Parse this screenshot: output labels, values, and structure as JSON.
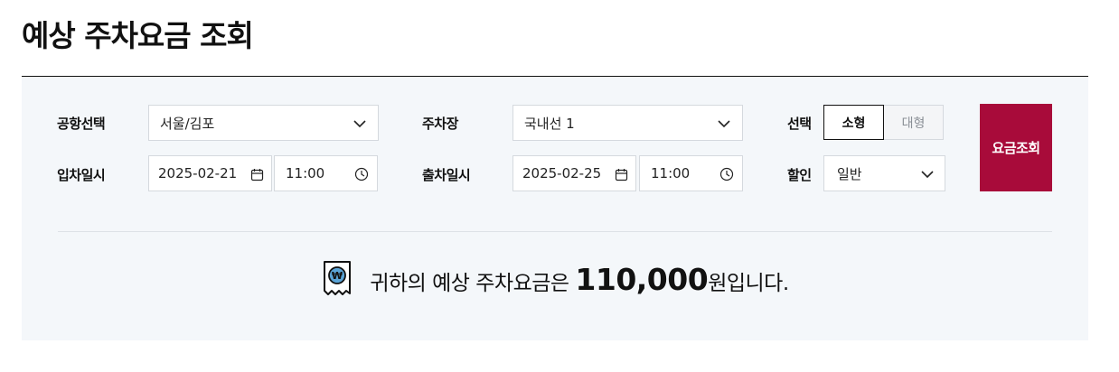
{
  "header": {
    "title": "예상 주차요금 조회"
  },
  "form": {
    "airport": {
      "label": "공항선택",
      "value": "서울/김포"
    },
    "parking_lot": {
      "label": "주차장",
      "value": "국내선 1"
    },
    "vehicle": {
      "label": "선택",
      "options": [
        "소형",
        "대형"
      ],
      "selected": "소형"
    },
    "entry": {
      "label": "입차일시",
      "date": "2025-02-21",
      "time": "11:00"
    },
    "exit": {
      "label": "출차일시",
      "date": "2025-02-25",
      "time": "11:00"
    },
    "discount": {
      "label": "할인",
      "value": "일반"
    },
    "search_button": "요금조회"
  },
  "result": {
    "prefix": "귀하의 예상 주차요금은 ",
    "amount": "110,000",
    "suffix": "원입니다."
  },
  "colors": {
    "accent": "#a80b3a",
    "panel_bg": "#f4f7fa",
    "icon_blue": "#5aa3d6"
  },
  "icons": [
    "chevron-down-icon",
    "calendar-icon",
    "clock-icon",
    "receipt-won-icon"
  ]
}
